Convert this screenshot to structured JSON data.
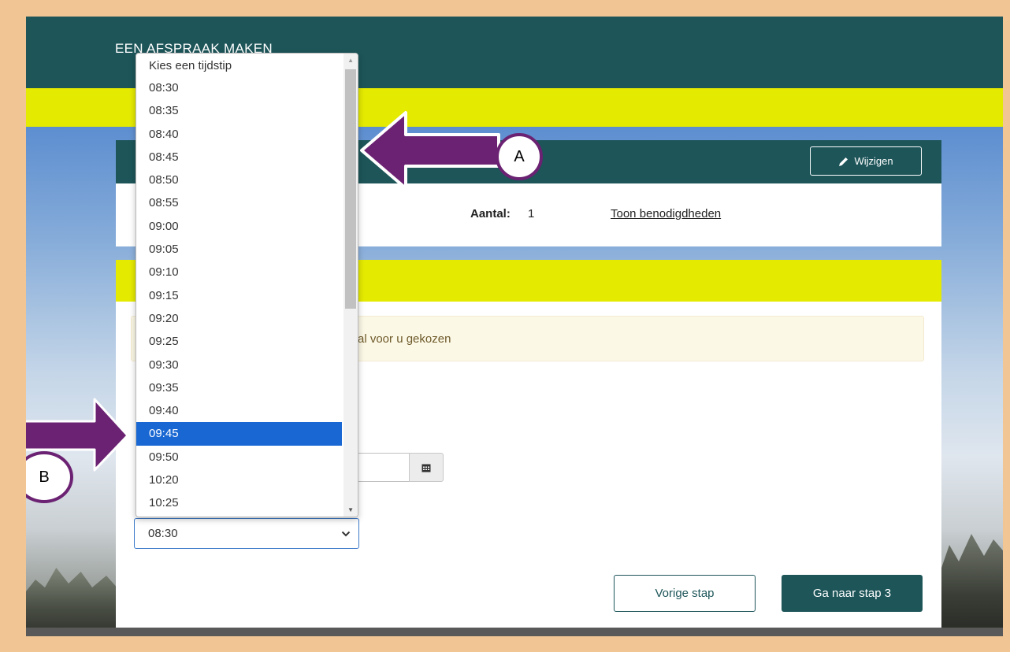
{
  "header": {
    "title": "EEN AFSPRAAK MAKEN"
  },
  "card1": {
    "edit_label": "Wijzigen",
    "amount_label": "Aantal:",
    "amount_value": "1",
    "supplies_link": "Toon benodigdheden"
  },
  "card2": {
    "notice_text": "al voor u gekozen",
    "time_select_value": "08:30"
  },
  "dropdown": {
    "placeholder": "Kies een tijdstip",
    "options": [
      "08:30",
      "08:35",
      "08:40",
      "08:45",
      "08:50",
      "08:55",
      "09:00",
      "09:05",
      "09:10",
      "09:15",
      "09:20",
      "09:25",
      "09:30",
      "09:35",
      "09:40",
      "09:45",
      "09:50",
      "10:20",
      "10:25"
    ],
    "highlighted": "09:45"
  },
  "footer": {
    "prev_label": "Vorige stap",
    "next_label": "Ga naar stap 3"
  },
  "annotations": {
    "a": "A",
    "b": "B"
  },
  "colors": {
    "brand_teal": "#1d5559",
    "brand_yellow": "#e4ea00",
    "highlight_blue": "#1967d2",
    "annotation_purple": "#6b2272",
    "frame_border": "#f1c594"
  },
  "icons": [
    "pencil-icon",
    "calendar-icon",
    "chevron-down-icon",
    "arrow-left-icon",
    "arrow-right-icon"
  ]
}
